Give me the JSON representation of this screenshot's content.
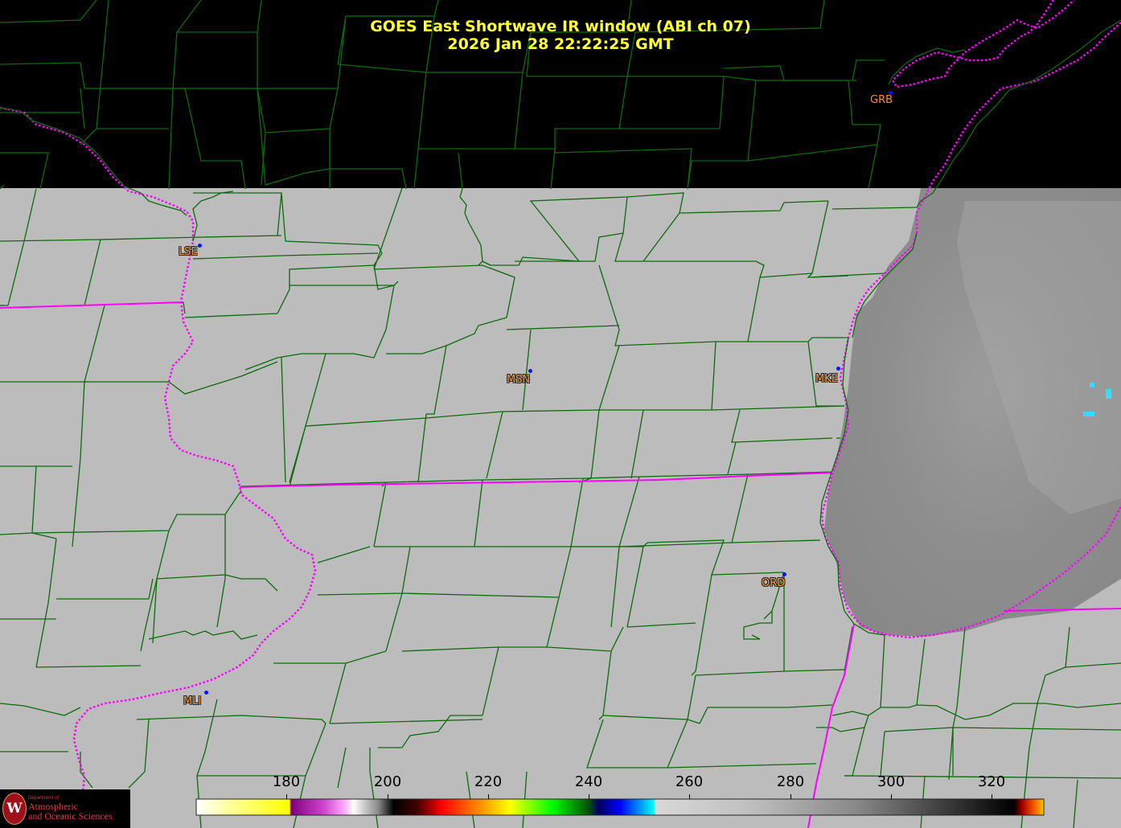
{
  "title": {
    "line1": "GOES East Shortwave IR window (ABI ch 07)",
    "line2": "2026 Jan 28  22:22:25 GMT"
  },
  "cities": [
    {
      "id": "grb",
      "label": "GRB"
    },
    {
      "id": "lse",
      "label": "LSE"
    },
    {
      "id": "msn",
      "label": "MSN"
    },
    {
      "id": "mke",
      "label": "MKE"
    },
    {
      "id": "ord",
      "label": "ORD"
    },
    {
      "id": "mli",
      "label": "MLI"
    }
  ],
  "colorbar": {
    "ticks": [
      "180",
      "200",
      "220",
      "240",
      "260",
      "280",
      "300",
      "320"
    ]
  },
  "logo": {
    "dept": "Department of",
    "line1": "Atmospheric",
    "line2": "and Oceanic Sciences"
  },
  "colors": {
    "title": "#ffff33",
    "county_lines": "#006400",
    "state_lines": "#ff00ff",
    "city_labels": "#ff9933",
    "station_dots": "#1010ff"
  }
}
